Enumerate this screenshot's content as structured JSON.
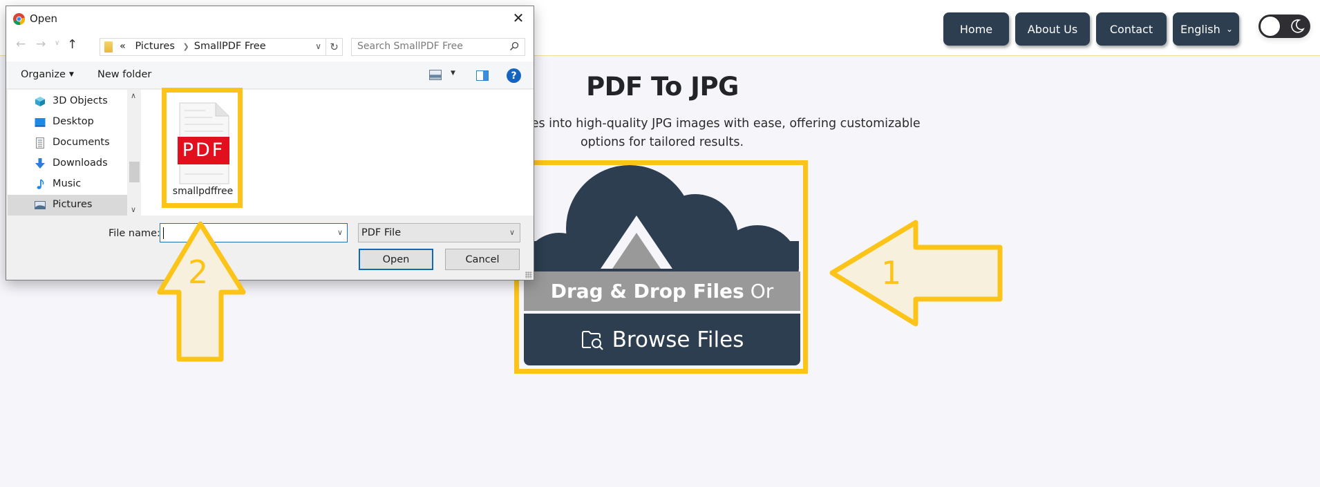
{
  "site": {
    "nav": {
      "home": "Home",
      "about": "About Us",
      "contact": "Contact",
      "language": "English"
    },
    "theme_toggle": {
      "mode": "light",
      "icon": "moon-icon"
    },
    "title": "PDF To JPG",
    "description": "Converts your PDF files into high-quality JPG images with ease, offering customizable options for tailored results.",
    "upload": {
      "drag_text_bold": "Drag & Drop Files",
      "drag_text_or": "Or",
      "browse_label": "Browse Files",
      "browse_icon": "folder-search-icon"
    },
    "colors": {
      "primary": "#2c3e50",
      "band_gray": "#999999",
      "highlight": "#fcc419",
      "background": "#f5f5fa"
    }
  },
  "annotations": {
    "arrow_1": "1",
    "arrow_2": "2"
  },
  "dialog": {
    "title": "Open",
    "close_label": "✕",
    "breadcrumb": {
      "overflow": "«",
      "items": [
        "Pictures",
        "SmallPDF Free"
      ]
    },
    "search_placeholder": "Search SmallPDF Free",
    "toolbar": {
      "organize": "Organize",
      "new_folder": "New folder",
      "help": "?"
    },
    "nav_pane": [
      {
        "label": "3D Objects",
        "icon": "3d-objects-icon"
      },
      {
        "label": "Desktop",
        "icon": "desktop-icon"
      },
      {
        "label": "Documents",
        "icon": "documents-icon"
      },
      {
        "label": "Downloads",
        "icon": "downloads-icon"
      },
      {
        "label": "Music",
        "icon": "music-icon"
      },
      {
        "label": "Pictures",
        "icon": "pictures-icon",
        "selected": true
      }
    ],
    "files": [
      {
        "name": "smallpdffree",
        "badge": "PDF"
      }
    ],
    "file_name_label": "File name:",
    "file_name_value": "",
    "file_type": "PDF File",
    "open_button": "Open",
    "cancel_button": "Cancel"
  }
}
